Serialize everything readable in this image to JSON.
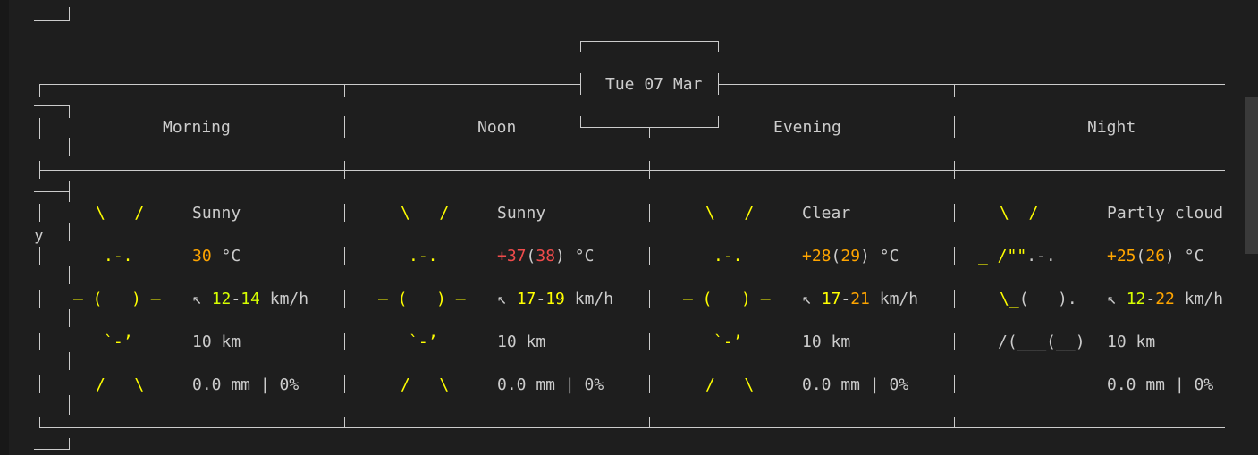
{
  "forecast": {
    "date": "Tue 07 Mar",
    "periods": [
      {
        "name": "Morning",
        "icon": {
          "row1": "\\   /",
          "row2": ".-.",
          "row3": "― (   ) ―",
          "row4": "`-’",
          "row5": "/   \\"
        },
        "condition": "Sunny",
        "temp": {
          "main": "30",
          "feels": "",
          "unit": "°C"
        },
        "wind": {
          "arrow": "↖",
          "low": "12",
          "sep": "-",
          "high": "14",
          "unit": "km/h"
        },
        "visibility": "10 km",
        "precip": "0.0 mm | 0%"
      },
      {
        "name": "Noon",
        "icon": {
          "row1": "\\   /",
          "row2": ".-.",
          "row3": "― (   ) ―",
          "row4": "`-’",
          "row5": "/   \\"
        },
        "condition": "Sunny",
        "temp": {
          "main": "+37",
          "feels": "38",
          "unit": "°C"
        },
        "wind": {
          "arrow": "↖",
          "low": "17",
          "sep": "-",
          "high": "19",
          "unit": "km/h"
        },
        "visibility": "10 km",
        "precip": "0.0 mm | 0%"
      },
      {
        "name": "Evening",
        "icon": {
          "row1": "\\   /",
          "row2": ".-.",
          "row3": "― (   ) ―",
          "row4": "`-’",
          "row5": "/   \\"
        },
        "condition": "Clear",
        "temp": {
          "main": "+28",
          "feels": "29",
          "unit": "°C"
        },
        "wind": {
          "arrow": "↖",
          "low": "17",
          "sep": "-",
          "high": "21",
          "unit": "km/h"
        },
        "visibility": "10 km",
        "precip": "0.0 mm | 0%"
      },
      {
        "name": "Night",
        "icon": {
          "row1": "\\  /",
          "row2a": "_ /\"\"",
          "row2b": ".-.",
          "row3a": "\\_",
          "row3b": "(   ).",
          "row4": "/(___(__)",
          "row5": ""
        },
        "condition": "Partly cloud",
        "temp": {
          "main": "+25",
          "feels": "26",
          "unit": "°C"
        },
        "wind": {
          "arrow": "↖",
          "low": "12",
          "sep": "-",
          "high": "22",
          "unit": "km/h"
        },
        "visibility": "10 km",
        "precip": "0.0 mm | 0%"
      }
    ],
    "stray_char": "y"
  },
  "colors": {
    "background": "#1e1e1e",
    "text": "#cccccc",
    "sun": "#ffff00",
    "temp_warm": "#ffa500",
    "temp_hot": "#f14c4c",
    "wind_low": "#d7ff00"
  }
}
